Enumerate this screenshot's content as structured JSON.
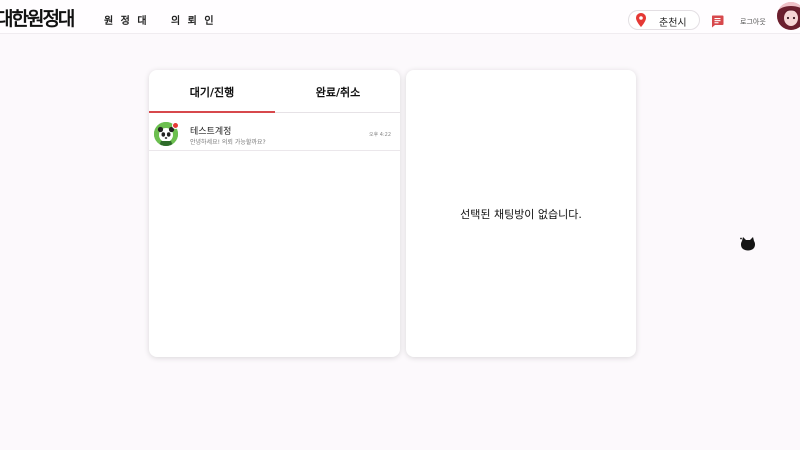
{
  "header": {
    "logo": "대한원정대",
    "nav": [
      "원 정 대",
      "의 뢰 인"
    ],
    "region": "춘천시",
    "logout": "로그아웃"
  },
  "tabs": [
    "대기/진행",
    "완료/취소"
  ],
  "rooms": [
    {
      "name": "테스트계정",
      "message": "안녕하세요! 의뢰 가능할까요?",
      "time": "오후 4:22"
    }
  ],
  "empty_message": "선택된 채팅방이 없습니다.",
  "colors": {
    "accent": "#d7484c",
    "background": "#fcf9fc"
  }
}
